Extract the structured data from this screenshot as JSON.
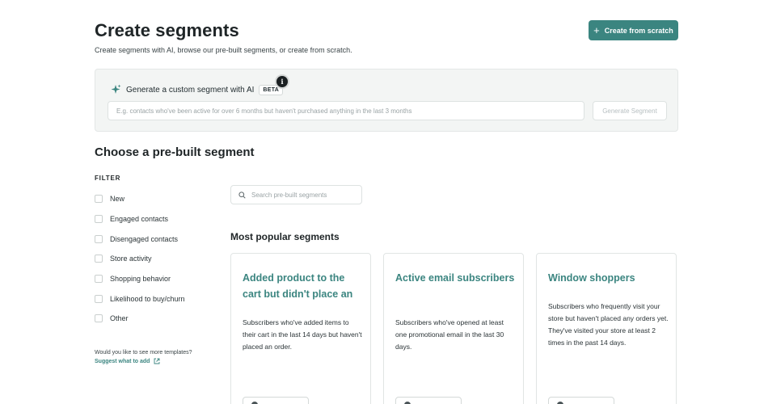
{
  "header": {
    "title": "Create segments",
    "subtitle": "Create segments with AI, browse our pre-built segments, or create from scratch.",
    "create_button": "Create from scratch"
  },
  "ai": {
    "title": "Generate a custom segment with AI",
    "badge": "BETA",
    "info": "i",
    "input_placeholder": "E.g. contacts who've been active for over 6 months but haven't purchased anything in the last 3 months",
    "generate_button": "Generate Segment"
  },
  "prebuilt": {
    "title": "Choose a pre-built segment",
    "filter_label": "FILTER",
    "filters": [
      "New",
      "Engaged contacts",
      "Disengaged contacts",
      "Store activity",
      "Shopping behavior",
      "Likelihood to buy/churn",
      "Other"
    ],
    "more_templates": "Would you like to see more templates?",
    "suggest_link": "Suggest what to add",
    "search_placeholder": "Search pre-built segments",
    "popular_title": "Most popular segments",
    "cards": [
      {
        "title": "Added product to the cart but didn't place an",
        "description": "Subscribers who've added items to their cart in the last 14 days but haven't placed an order."
      },
      {
        "title": "Active email subscribers",
        "description": "Subscribers who've opened at least one promotional email in the last 30 days."
      },
      {
        "title": "Window shoppers",
        "description": "Subscribers who frequently visit your store but haven't placed any orders yet. They've visited your store at least 2 times in the past 14 days."
      }
    ]
  },
  "colors": {
    "accent": "#3b8580",
    "text": "#1f2527",
    "panel_bg": "#f3f5f4"
  }
}
